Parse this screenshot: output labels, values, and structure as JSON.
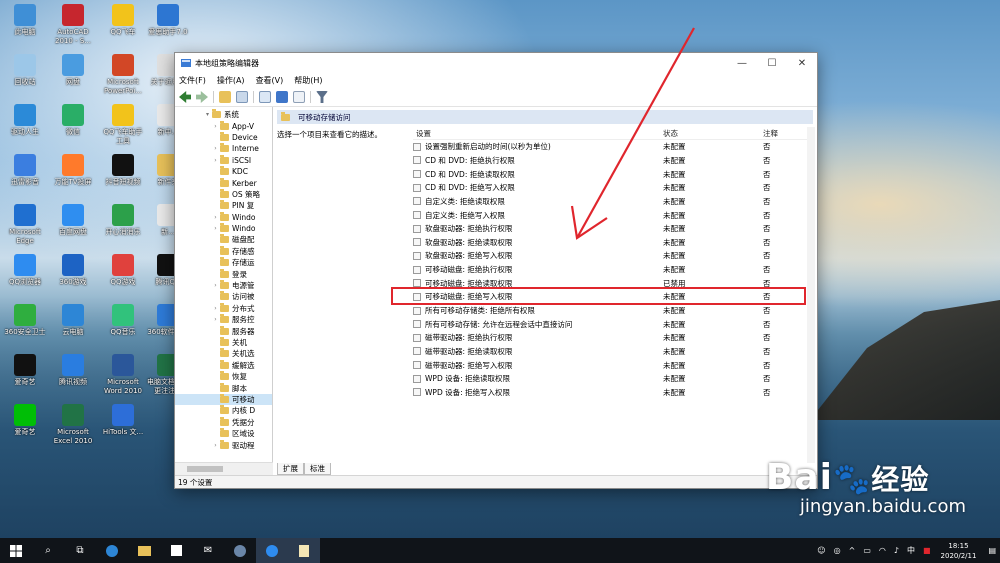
{
  "desktop_icons": [
    {
      "label": "此电脑",
      "color": "#3f8fd6"
    },
    {
      "label": "AutoCAD 2010 - S...",
      "color": "#c6262e"
    },
    {
      "label": "QQ飞车",
      "color": "#f2c31b"
    },
    {
      "label": "爱思助手7.0",
      "color": "#2d76d2"
    },
    {
      "label": "回收站",
      "color": "#9cc7e8"
    },
    {
      "label": "网盘",
      "color": "#4a9ce0"
    },
    {
      "label": "Microsoft PowerPoi...",
      "color": "#d24726"
    },
    {
      "label": "关于近月...",
      "color": "#e0e0e0"
    },
    {
      "label": "驱动人生",
      "color": "#2b8ad8"
    },
    {
      "label": "微信",
      "color": "#2aae67"
    },
    {
      "label": "QQ飞车助手工具",
      "color": "#f2c31b"
    },
    {
      "label": "新中...",
      "color": "#e9e9e9"
    },
    {
      "label": "迅雷影音",
      "color": "#3b7ee0"
    },
    {
      "label": "万能TV投屏",
      "color": "#ff7a2b"
    },
    {
      "label": "抖音短视频",
      "color": "#111111"
    },
    {
      "label": "新件夹",
      "color": "#e8c15a"
    },
    {
      "label": "Microsoft Edge",
      "color": "#1f6fd0"
    },
    {
      "label": "百度网盘",
      "color": "#2f8ef0"
    },
    {
      "label": "开心消消乐",
      "color": "#2ca04a"
    },
    {
      "label": "新...",
      "color": "#e9e9e9"
    },
    {
      "label": "QQ浏览器",
      "color": "#2e8cf0"
    },
    {
      "label": "360游戏",
      "color": "#1d63c4"
    },
    {
      "label": "QQ游戏",
      "color": "#e0413d"
    },
    {
      "label": "腾讯QQ",
      "color": "#111111"
    },
    {
      "label": "360安全卫士",
      "color": "#2fae3f"
    },
    {
      "label": "云电脑",
      "color": "#2d86d6"
    },
    {
      "label": "QQ音乐",
      "color": "#31c27c"
    },
    {
      "label": "360软件管家",
      "color": "#2e7bd8"
    },
    {
      "label": "爱奇艺",
      "color": "#111111"
    },
    {
      "label": "腾讯视频",
      "color": "#2a7de0"
    },
    {
      "label": "Microsoft Word 2010",
      "color": "#2b579a"
    },
    {
      "label": "电脑文档关于更注注...",
      "color": "#217346"
    },
    {
      "label": "爱奇艺",
      "color": "#00be06"
    },
    {
      "label": "Microsoft Excel 2010",
      "color": "#217346"
    },
    {
      "label": "HiTools 文...",
      "color": "#2d6ed8"
    }
  ],
  "window": {
    "title": "本地组策略编辑器",
    "controls": {
      "minimize": "—",
      "maximize": "☐",
      "close": "✕"
    },
    "menu": [
      "文件(F)",
      "操作(A)",
      "查看(V)",
      "帮助(H)"
    ],
    "tree": [
      {
        "label": "系统",
        "indent": 2,
        "arrow": "▾"
      },
      {
        "label": "App-V",
        "indent": 3,
        "arrow": "›"
      },
      {
        "label": "Device",
        "indent": 3,
        "arrow": ""
      },
      {
        "label": "Interne",
        "indent": 3,
        "arrow": "›"
      },
      {
        "label": "iSCSI",
        "indent": 3,
        "arrow": "›"
      },
      {
        "label": "KDC",
        "indent": 3,
        "arrow": ""
      },
      {
        "label": "Kerber",
        "indent": 3,
        "arrow": ""
      },
      {
        "label": "OS 策略",
        "indent": 3,
        "arrow": ""
      },
      {
        "label": "PIN 复",
        "indent": 3,
        "arrow": ""
      },
      {
        "label": "Windo",
        "indent": 3,
        "arrow": "›"
      },
      {
        "label": "Windo",
        "indent": 3,
        "arrow": "›"
      },
      {
        "label": "磁盘配",
        "indent": 3,
        "arrow": ""
      },
      {
        "label": "存储感",
        "indent": 3,
        "arrow": ""
      },
      {
        "label": "存储运",
        "indent": 3,
        "arrow": ""
      },
      {
        "label": "登录",
        "indent": 3,
        "arrow": ""
      },
      {
        "label": "电源管",
        "indent": 3,
        "arrow": "›"
      },
      {
        "label": "访问被",
        "indent": 3,
        "arrow": ""
      },
      {
        "label": "分布式",
        "indent": 3,
        "arrow": "›"
      },
      {
        "label": "服务控",
        "indent": 3,
        "arrow": "›"
      },
      {
        "label": "服务器",
        "indent": 3,
        "arrow": ""
      },
      {
        "label": "关机",
        "indent": 3,
        "arrow": ""
      },
      {
        "label": "关机选",
        "indent": 3,
        "arrow": ""
      },
      {
        "label": "缓解选",
        "indent": 3,
        "arrow": ""
      },
      {
        "label": "恢复",
        "indent": 3,
        "arrow": ""
      },
      {
        "label": "脚本",
        "indent": 3,
        "arrow": ""
      },
      {
        "label": "可移动",
        "indent": 3,
        "arrow": "",
        "selected": true
      },
      {
        "label": "内核 D",
        "indent": 3,
        "arrow": ""
      },
      {
        "label": "凭据分",
        "indent": 3,
        "arrow": ""
      },
      {
        "label": "区域设",
        "indent": 3,
        "arrow": ""
      },
      {
        "label": "驱动程",
        "indent": 3,
        "arrow": "›"
      }
    ],
    "breadcrumb": "可移动存储访问",
    "description": "选择一个项目来查看它的描述。",
    "columns": {
      "setting": "设置",
      "state": "状态",
      "comment": "注释"
    },
    "rows": [
      {
        "name": "设置强制重新启动的时间(以秒为单位)",
        "state": "未配置",
        "comment": "否"
      },
      {
        "name": "CD 和 DVD: 拒绝执行权限",
        "state": "未配置",
        "comment": "否"
      },
      {
        "name": "CD 和 DVD: 拒绝读取权限",
        "state": "未配置",
        "comment": "否"
      },
      {
        "name": "CD 和 DVD: 拒绝写入权限",
        "state": "未配置",
        "comment": "否"
      },
      {
        "name": "自定义类: 拒绝读取权限",
        "state": "未配置",
        "comment": "否"
      },
      {
        "name": "自定义类: 拒绝写入权限",
        "state": "未配置",
        "comment": "否"
      },
      {
        "name": "软盘驱动器: 拒绝执行权限",
        "state": "未配置",
        "comment": "否"
      },
      {
        "name": "软盘驱动器: 拒绝读取权限",
        "state": "未配置",
        "comment": "否"
      },
      {
        "name": "软盘驱动器: 拒绝写入权限",
        "state": "未配置",
        "comment": "否"
      },
      {
        "name": "可移动磁盘: 拒绝执行权限",
        "state": "未配置",
        "comment": "否"
      },
      {
        "name": "可移动磁盘: 拒绝读取权限",
        "state": "已禁用",
        "comment": "否"
      },
      {
        "name": "可移动磁盘: 拒绝写入权限",
        "state": "未配置",
        "comment": "否"
      },
      {
        "name": "所有可移动存储类: 拒绝所有权限",
        "state": "未配置",
        "comment": "否"
      },
      {
        "name": "所有可移动存储: 允许在远程会话中直接访问",
        "state": "未配置",
        "comment": "否"
      },
      {
        "name": "磁带驱动器: 拒绝执行权限",
        "state": "未配置",
        "comment": "否"
      },
      {
        "name": "磁带驱动器: 拒绝读取权限",
        "state": "未配置",
        "comment": "否"
      },
      {
        "name": "磁带驱动器: 拒绝写入权限",
        "state": "未配置",
        "comment": "否"
      },
      {
        "name": "WPD 设备: 拒绝读取权限",
        "state": "未配置",
        "comment": "否"
      },
      {
        "name": "WPD 设备: 拒绝写入权限",
        "state": "未配置",
        "comment": "否"
      }
    ],
    "tabs": [
      "扩展",
      "标准"
    ],
    "status": "19 个设置"
  },
  "taskbar": {
    "icons": [
      "start-icon",
      "search-icon",
      "task-view-icon",
      "edge-icon",
      "file-explorer-icon",
      "store-icon",
      "mail-icon",
      "app-icon",
      "qq-browser-icon",
      "notepad-icon"
    ],
    "tray_text": "中",
    "time": "18:15",
    "date": "2020/2/11"
  },
  "watermark": {
    "brand": "Bai",
    "brand_cn": "经验",
    "url": "jingyan.baidu.com"
  }
}
